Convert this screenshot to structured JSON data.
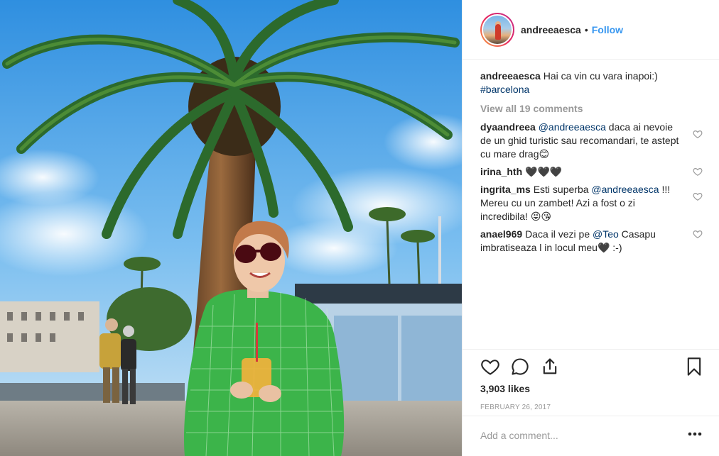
{
  "post": {
    "photo_alt": "Woman in green dress with sunglasses sitting under a palm tree in Barcelona"
  },
  "header": {
    "username": "andreeaesca",
    "separator": "•",
    "follow_label": "Follow"
  },
  "caption": {
    "username": "andreeaesca",
    "text": "Hai ca vin cu vara inapoi:)",
    "hashtag": "#barcelona"
  },
  "view_all": "View all 19 comments",
  "comments": [
    {
      "username": "dyaandreea",
      "mention": "@andreeaesca",
      "text": " daca ai nevoie de un ghid turistic sau recomandari, te astept cu mare drag😊"
    },
    {
      "username": "irina_hth",
      "text": "🖤🖤🖤"
    },
    {
      "username": "ingrita_ms",
      "text_before": "Esti superba ",
      "mention": "@andreeaesca",
      "text_after": " !!! Mereu cu un zambet! Azi a fost o zi incredibila! 😝😘"
    },
    {
      "username": "anael969",
      "text_before": "Daca il vezi pe ",
      "mention": "@Teo",
      "text_after": " Casapu imbratiseaza l in locul meu🖤 :-)"
    }
  ],
  "icons": {
    "like": "heart-icon",
    "comment": "comment-bubble-icon",
    "share": "share-icon",
    "save": "bookmark-icon",
    "more": "more-dots-icon"
  },
  "likes": "3,903 likes",
  "date": "FEBRUARY 26, 2017",
  "add_comment": {
    "placeholder": "Add a comment..."
  },
  "colors": {
    "accent": "#3897f0",
    "mention": "#003569",
    "muted": "#999999",
    "text": "#262626",
    "border": "#efefef"
  }
}
